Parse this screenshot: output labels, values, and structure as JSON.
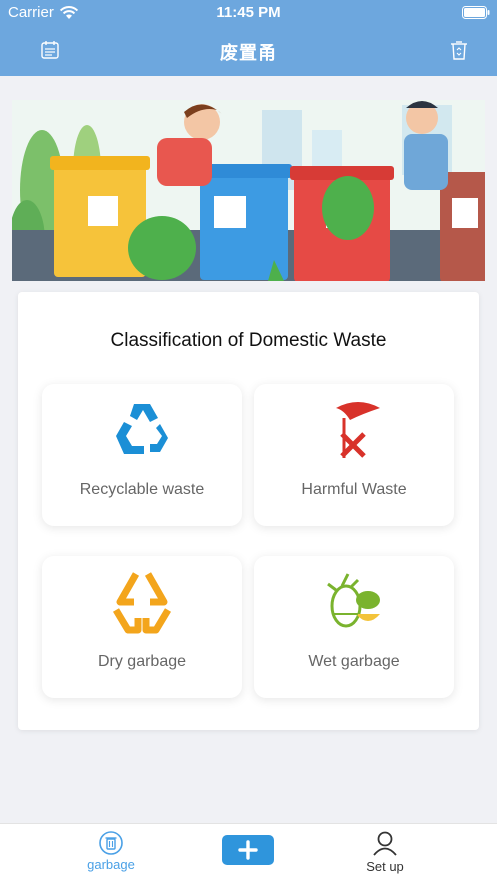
{
  "status_bar": {
    "carrier": "Carrier",
    "time": "11:45 PM"
  },
  "nav": {
    "title": "废置甬",
    "left_icon": "calendar-icon",
    "right_icon": "trash-icon"
  },
  "banner": {
    "description_icon": "garbage-sorting-banner"
  },
  "card": {
    "title": "Classification of Domestic Waste",
    "tiles": [
      {
        "label": "Recyclable waste",
        "icon": "recycle-icon",
        "color": "#1b8fd6"
      },
      {
        "label": "Harmful Waste",
        "icon": "harmful-icon",
        "color": "#d8322a"
      },
      {
        "label": "Dry garbage",
        "icon": "dry-garbage-icon",
        "color": "#f3a51c"
      },
      {
        "label": "Wet garbage",
        "icon": "wet-garbage-icon",
        "color": "#7ab32e"
      }
    ]
  },
  "tabbar": {
    "tabs": [
      {
        "label": "garbage",
        "icon": "trash-can-icon",
        "active": true
      },
      {
        "label": "",
        "icon": "plus-icon",
        "active": false
      },
      {
        "label": "Set up",
        "icon": "person-icon",
        "active": false
      }
    ],
    "active_color": "#4aa0e6",
    "inactive_color": "#333333",
    "add_color": "#2f95dc"
  }
}
